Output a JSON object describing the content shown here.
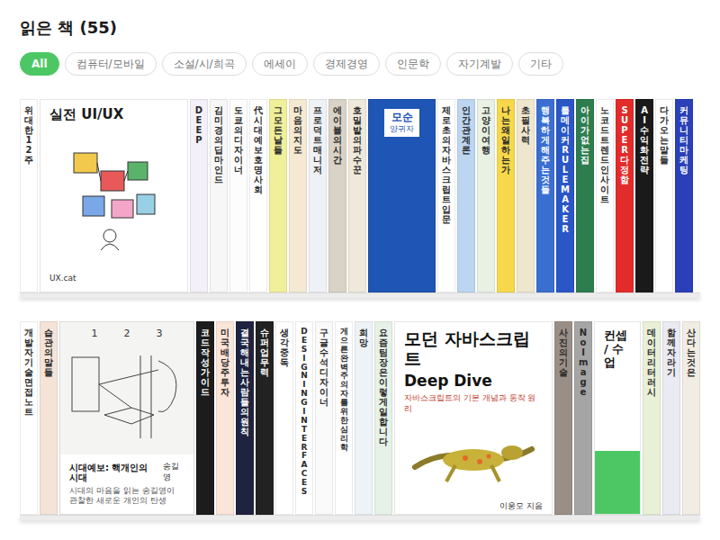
{
  "page": {
    "title": "읽은 책 (55)"
  },
  "filters": [
    {
      "label": "All",
      "selected": true
    },
    {
      "label": "컴퓨터/모바일",
      "selected": false
    },
    {
      "label": "소설/시/희곡",
      "selected": false
    },
    {
      "label": "에세이",
      "selected": false
    },
    {
      "label": "경제경영",
      "selected": false
    },
    {
      "label": "인문학",
      "selected": false
    },
    {
      "label": "자기계발",
      "selected": false
    },
    {
      "label": "기타",
      "selected": false
    }
  ],
  "shelves": [
    {
      "books": [
        {
          "kind": "spine",
          "color": "#ffffff",
          "title": "위대한 12주"
        },
        {
          "kind": "diagram-cover",
          "color": "#ffffff",
          "title": "실전 UI/UX",
          "author": "UX.cat"
        },
        {
          "kind": "spine",
          "color": "#f4f0fa",
          "title": "DEEP"
        },
        {
          "kind": "spine",
          "color": "#f7f7f7",
          "title": "김미경의 딥마인드"
        },
        {
          "kind": "spine",
          "color": "#fdfdfd",
          "title": "도쿄의 디자이너"
        },
        {
          "kind": "spine",
          "color": "#ffffff",
          "title": "代 시대예보 호명사회"
        },
        {
          "kind": "spine",
          "color": "#f0ef9a",
          "title": "그 모든 날들"
        },
        {
          "kind": "spine",
          "color": "#f6e9d3",
          "title": "마음의 지도"
        },
        {
          "kind": "spine",
          "color": "#eef1f6",
          "title": "프로덕트 매니저"
        },
        {
          "kind": "spine",
          "color": "#d9d2c6",
          "title": "에이블의 시간"
        },
        {
          "kind": "spine",
          "color": "#efe9dc",
          "title": "호밀밭의 파수꾼"
        },
        {
          "kind": "plain-cover",
          "color": "#1f55b5",
          "title": "모순",
          "author": "양귀자"
        },
        {
          "kind": "spine",
          "color": "#ffffff",
          "title": "제로초의 자바스크립트 입문"
        },
        {
          "kind": "spine",
          "color": "#bcd6f2",
          "title": "인간관계론"
        },
        {
          "kind": "spine",
          "color": "#e8f1e4",
          "title": "고양이 여행"
        },
        {
          "kind": "spine",
          "color": "#f7d84a",
          "title": "나는 왜 일하는가"
        },
        {
          "kind": "spine",
          "color": "#efe6cf",
          "title": "초필사력"
        },
        {
          "kind": "spine",
          "color": "#3a6fd1",
          "title": "행복하게 해주는 것들"
        },
        {
          "kind": "spine",
          "color": "#2a56c6",
          "title": "룰 메이커 RULE MAKER"
        },
        {
          "kind": "spine",
          "color": "#2e7d4f",
          "title": "아이가 없는 집"
        },
        {
          "kind": "spine",
          "color": "#ffffff",
          "title": "노코드 트렌드 인사이트"
        },
        {
          "kind": "spine",
          "color": "#e32b2b",
          "title": "SUPER 다정함"
        },
        {
          "kind": "spine",
          "color": "#1a1a1a",
          "title": "AI 수익화 전략"
        },
        {
          "kind": "spine",
          "color": "#ffffff",
          "title": "다가오는 말들"
        },
        {
          "kind": "spine",
          "color": "#2a3fb8",
          "title": "커뮤니티 마케팅"
        }
      ]
    },
    {
      "books": [
        {
          "kind": "spine",
          "color": "#ffffff",
          "title": "개발자 기술 면접 노트"
        },
        {
          "kind": "spine",
          "color": "#f5e3d8",
          "title": "습관의 말들"
        },
        {
          "kind": "sketch-cover",
          "color": "#f4f4f2",
          "title": "시대예보: 핵개인의 시대",
          "subtitle": "시대의 마음을 읽는 송길영이 관찰한 새로운 개인의 탄생",
          "author": "송길영",
          "marks": [
            "1",
            "2",
            "3"
          ]
        },
        {
          "kind": "spine",
          "color": "#1c1c1c",
          "title": "코드 작성 가이드"
        },
        {
          "kind": "spine",
          "color": "#fbe4d8",
          "title": "미국 배당주 투자"
        },
        {
          "kind": "spine",
          "color": "#1f2340",
          "title": "결국 해내는 사람들의 원칙"
        },
        {
          "kind": "spine",
          "color": "#222222",
          "title": "슈퍼 업무력"
        },
        {
          "kind": "spine",
          "color": "#ffffff",
          "title": "생각 중독"
        },
        {
          "kind": "spine",
          "color": "#ffffff",
          "title": "DESIGNING INTERFACES"
        },
        {
          "kind": "spine",
          "color": "#fafafa",
          "title": "구글 수석 디자이너"
        },
        {
          "kind": "spine",
          "color": "#ffffff",
          "title": "게으른 완벽주의자를 위한 심리학"
        },
        {
          "kind": "spine",
          "color": "#eef3f8",
          "title": "희망"
        },
        {
          "kind": "spine",
          "color": "#e6f2e8",
          "title": "요즘 팀장은 이렇게 일합니다"
        },
        {
          "kind": "lizard-cover",
          "color": "#ffffff",
          "title": "모던 자바스크립트",
          "subtitle": "Deep Dive",
          "note": "자바스크립트의 기본 개념과 동작 원리",
          "author": "이웅모 지음"
        },
        {
          "kind": "spine",
          "color": "#9a8f87",
          "title": "사진의 기술"
        },
        {
          "kind": "spine",
          "color": "#a5a5a5",
          "title": "No Image"
        },
        {
          "kind": "label-cover",
          "color": "#ffffff",
          "title": "컨셉 / 수업"
        },
        {
          "kind": "spine",
          "color": "#e8f0d8",
          "title": "데이터 리터러시"
        },
        {
          "kind": "spine",
          "color": "#eaeaf2",
          "title": "함께 자라기"
        },
        {
          "kind": "spine",
          "color": "#f1ece4",
          "title": "산다는 것은"
        }
      ]
    }
  ]
}
